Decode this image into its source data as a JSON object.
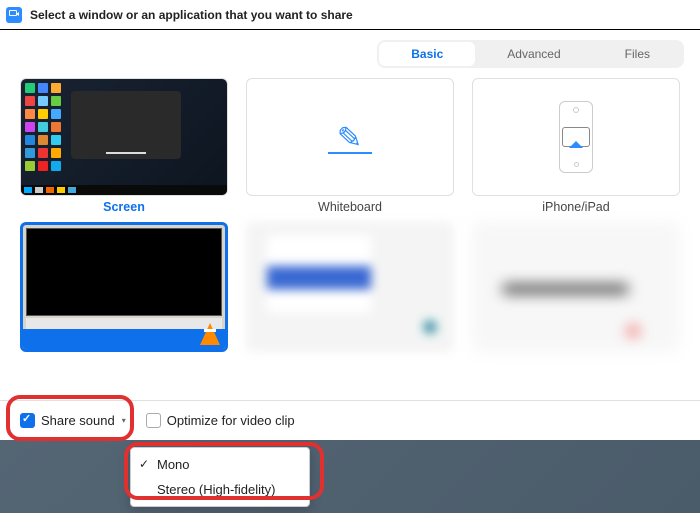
{
  "titlebar": {
    "text": "Select a window or an application that you want to share"
  },
  "tabs": {
    "basic": "Basic",
    "advanced": "Advanced",
    "files": "Files"
  },
  "items": {
    "screen": "Screen",
    "whiteboard": "Whiteboard",
    "iphone": "iPhone/iPad"
  },
  "footer": {
    "share_sound": "Share sound",
    "optimize": "Optimize for video clip"
  },
  "dropdown": {
    "mono": "Mono",
    "stereo": "Stereo (High-fidelity)"
  }
}
